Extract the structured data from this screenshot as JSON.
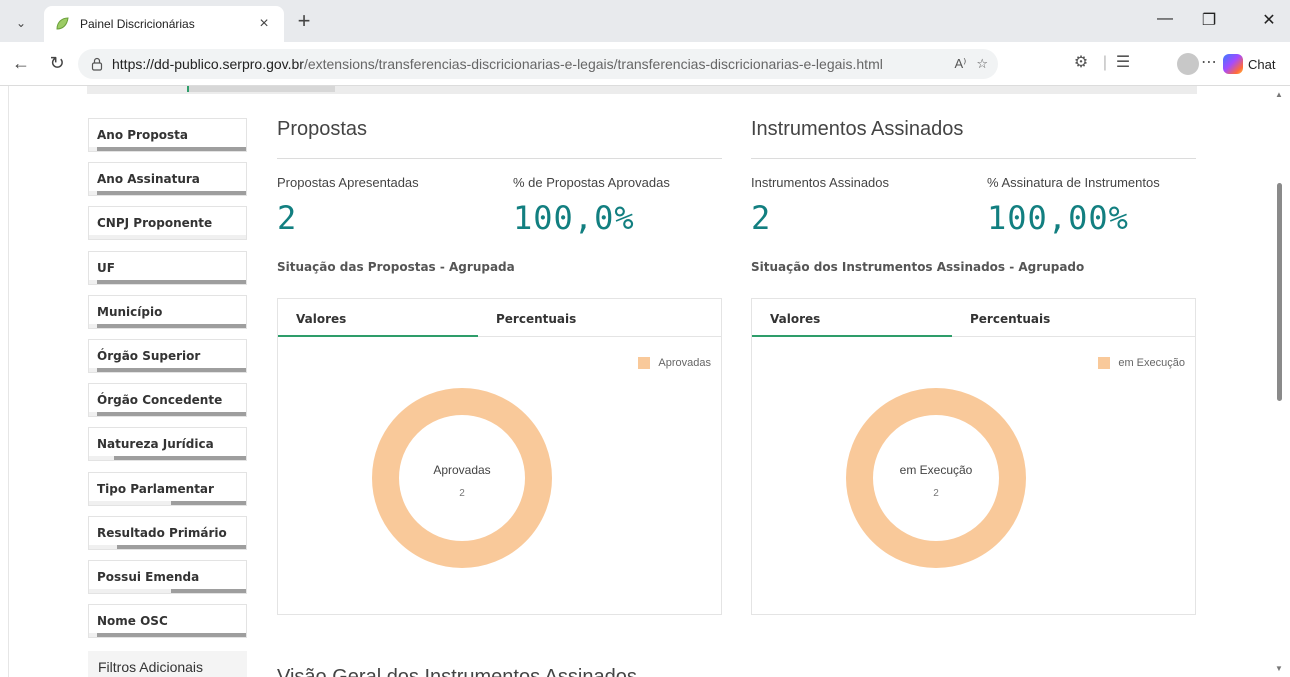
{
  "browser": {
    "tab_title": "Painel Discricionárias",
    "new_tab_label": "+",
    "url_host": "https://dd-publico.serpro.gov.br",
    "url_path": "/extensions/transferencias-discricionarias-e-legais/transferencias-discricionarias-e-legais.html",
    "chat_label": "Chat"
  },
  "filters": [
    {
      "label": "Ano Proposta",
      "bar_fill": 0.95
    },
    {
      "label": "Ano Assinatura",
      "bar_fill": 0.95
    },
    {
      "label": "CNPJ Proponente",
      "bar_fill": 0.0
    },
    {
      "label": "UF",
      "bar_fill": 0.95
    },
    {
      "label": "Município",
      "bar_fill": 0.95
    },
    {
      "label": "Órgão Superior",
      "bar_fill": 0.95
    },
    {
      "label": "Órgão Concedente",
      "bar_fill": 0.95
    },
    {
      "label": "Natureza Jurídica",
      "bar_fill": 0.84
    },
    {
      "label": "Tipo Parlamentar",
      "bar_fill": 0.48
    },
    {
      "label": "Resultado Primário",
      "bar_fill": 0.82
    },
    {
      "label": "Possui Emenda",
      "bar_fill": 0.48
    },
    {
      "label": "Nome OSC",
      "bar_fill": 0.95
    }
  ],
  "extra_filters_label": "Filtros Adicionais",
  "propostas": {
    "title": "Propostas",
    "kpi1_label": "Propostas Apresentadas",
    "kpi1_value": "2",
    "kpi2_label": "% de Propostas Aprovadas",
    "kpi2_value": "100,0%",
    "chart_heading": "Situação das Propostas - Agrupada",
    "tab_values": "Valores",
    "tab_percent": "Percentuais",
    "legend": "Aprovadas",
    "center_label": "Aprovadas",
    "center_value": "2"
  },
  "instrumentos": {
    "title": "Instrumentos Assinados",
    "kpi1_label": "Instrumentos Assinados",
    "kpi1_value": "2",
    "kpi2_label": "% Assinatura de Instrumentos",
    "kpi2_value": "100,00%",
    "chart_heading": "Situação dos Instrumentos Assinados - Agrupado",
    "tab_values": "Valores",
    "tab_percent": "Percentuais",
    "legend": "em Execução",
    "center_label": "em Execução",
    "center_value": "2"
  },
  "below_heading": "Visão Geral dos Instrumentos Assinados",
  "chart_data": [
    {
      "type": "pie",
      "categories": [
        "Aprovadas"
      ],
      "values": [
        2
      ],
      "color": "#f9c99a"
    },
    {
      "type": "pie",
      "categories": [
        "em Execução"
      ],
      "values": [
        2
      ],
      "color": "#f9c99a"
    }
  ]
}
